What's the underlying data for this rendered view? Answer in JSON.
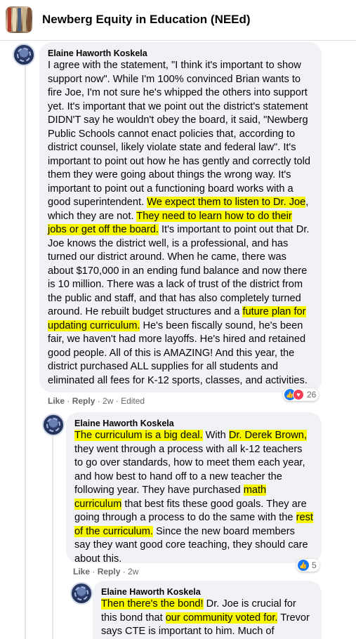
{
  "group": {
    "name": "Newberg Equity in Education (NEEd)"
  },
  "colors": {
    "highlight": "#f7f700",
    "bubble": "#f0f2f5",
    "like": "#1877f2",
    "love": "#f33e58"
  },
  "comments": [
    {
      "author": "Elaine Haworth Koskela",
      "segments": [
        {
          "t": "I agree with the statement, \"I think it's important to show support now\". While I'm 100% convinced Brian wants to fire Joe, I'm not sure he's whipped the others into support yet. It's important that we point out the district's statement DIDN'T say he wouldn't obey the board, it said, \"Newberg Public Schools cannot enact policies that, according to district counsel, likely violate state and federal law\". It's important to point out how he has gently and correctly told them they were going about things the wrong way. It's important to point out a functioning board works with a good superintendent. ",
          "h": false
        },
        {
          "t": "We expect them to listen to Dr. Joe",
          "h": true
        },
        {
          "t": ", which they are not. ",
          "h": false
        },
        {
          "t": "They need to learn how to do their jobs or get off the board.",
          "h": true
        },
        {
          "t": " It's important to point out that Dr. Joe knows the district well, is a professional, and has turned our district around. When he came, there was about $170,000 in an ending fund balance and now there is 10 million. There was a lack of trust of the district from the public and staff, and that has also completely turned around. He rebuilt budget structures and a ",
          "h": false
        },
        {
          "t": "future plan for updating curriculum.",
          "h": true
        },
        {
          "t": " He's been fiscally sound, he's been fair, we haven't had more layoffs. He's hired and retained good people. All of this is AMAZING! And this year, the district purchased ALL supplies for all students and eliminated all fees for K-12 sports, classes, and activities.",
          "h": false
        }
      ],
      "actions": {
        "like": "Like",
        "reply": "Reply",
        "time": "2w",
        "edited": "Edited"
      },
      "reaction_count": "26"
    },
    {
      "author": "Elaine Haworth Koskela",
      "segments": [
        {
          "t": "The curriculum is a big deal.",
          "h": true
        },
        {
          "t": " With ",
          "h": false
        },
        {
          "t": "Dr. Derek Brown,",
          "h": true
        },
        {
          "t": " they went through a process with all k-12 teachers to go over standards, how to meet them each year, and how best to hand off to a new teacher the following year. They have purchased ",
          "h": false
        },
        {
          "t": "math curriculum",
          "h": true
        },
        {
          "t": " that best fits these good goals. They are going through a process to do the same with the ",
          "h": false
        },
        {
          "t": "rest of the curriculum.",
          "h": true
        },
        {
          "t": " Since the new board members say they want good core teaching, they should care about this.",
          "h": false
        }
      ],
      "actions": {
        "like": "Like",
        "reply": "Reply",
        "time": "2w"
      },
      "reaction_count": "5"
    },
    {
      "author": "Elaine Haworth Koskela",
      "segments": [
        {
          "t": "Then there's the bond!",
          "h": true
        },
        {
          "t": " Dr. Joe is crucial for this bond that ",
          "h": false
        },
        {
          "t": "our community voted for.",
          "h": true
        },
        {
          "t": " Trevor says CTE is important to him. Much of",
          "h": false
        }
      ]
    }
  ]
}
